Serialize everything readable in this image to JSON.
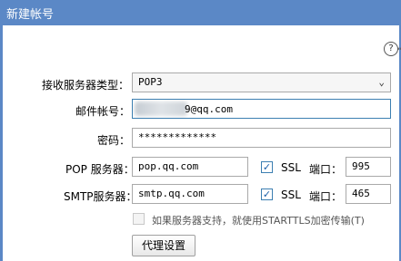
{
  "window": {
    "title": "新建帐号"
  },
  "help": {
    "icon": "help-icon",
    "glyph": "?"
  },
  "form": {
    "server_type_label": "接收服务器类型：",
    "server_type_value": "POP3",
    "account_label": "邮件帐号：",
    "account_value": "9@qq.com",
    "password_label": "密码：",
    "password_value": "*************",
    "pop_label": "POP 服务器：",
    "pop_value": "pop.qq.com",
    "pop_ssl_label": "SSL",
    "pop_port_label": "端口：",
    "pop_port_value": "995",
    "smtp_label": "SMTP服务器：",
    "smtp_value": "smtp.qq.com",
    "smtp_ssl_label": "SSL",
    "smtp_port_label": "端口：",
    "smtp_port_value": "465",
    "starttls_label": "如果服务器支持，就使用STARTTLS加密传输(T)",
    "proxy_button": "代理设置"
  }
}
